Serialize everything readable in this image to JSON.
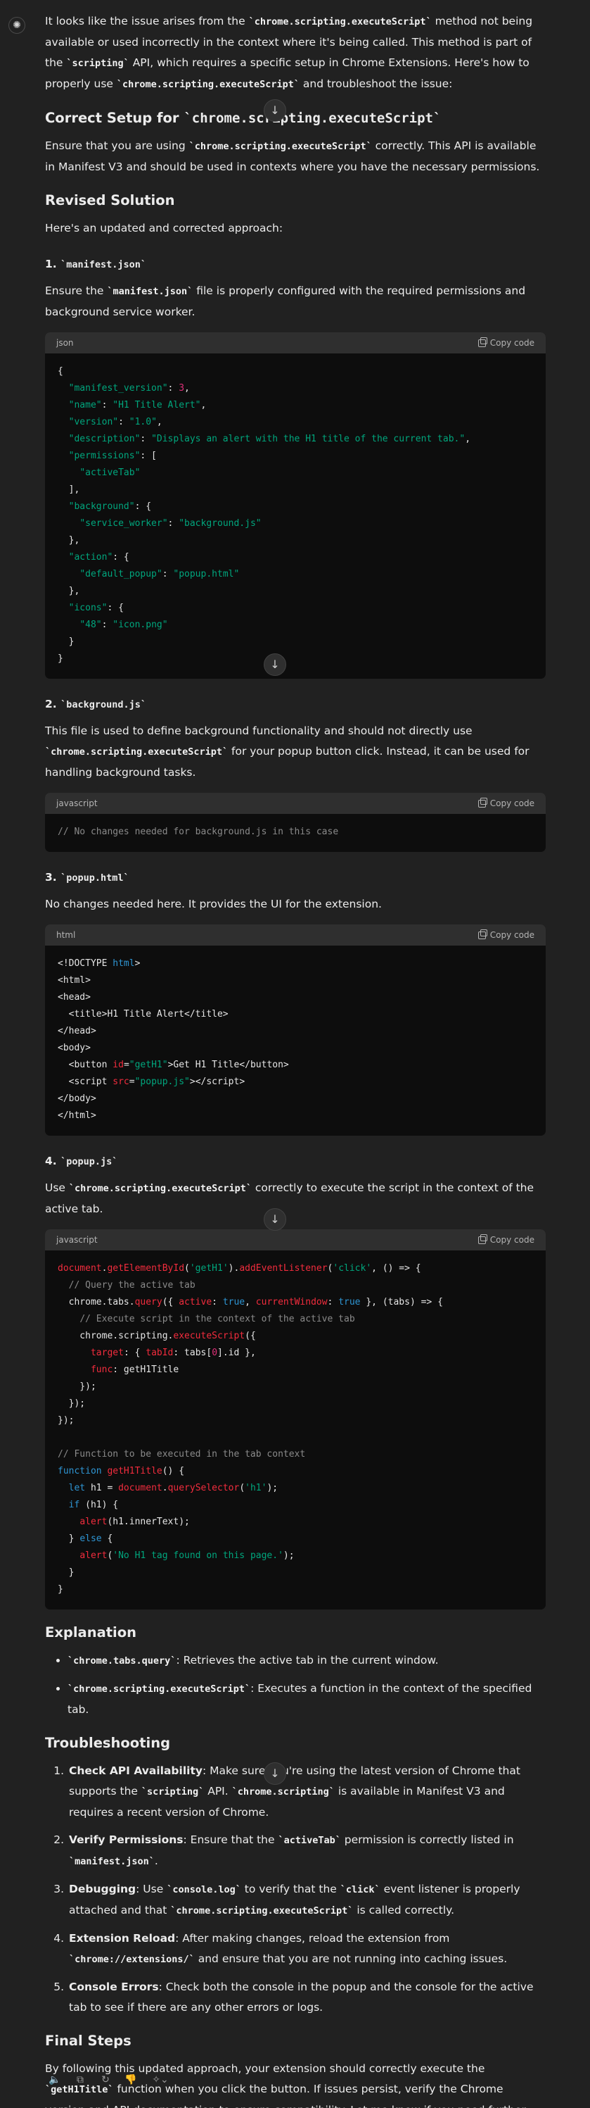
{
  "intro": {
    "p1_a": "It looks like the issue arises from the ",
    "p1_code1": "`chrome.scripting.executeScript`",
    "p1_b": " method not being available or used incorrectly in the context where it's being called. This method is part of the ",
    "p1_code2": "`scripting`",
    "p1_c": " API, which requires a specific setup in Chrome Extensions. Here's how to properly use ",
    "p1_code3": "`chrome.scripting.executeScript`",
    "p1_d": " and troubleshoot the issue:"
  },
  "correct_setup": {
    "heading_a": "Correct Setup for ",
    "heading_code": "`chrome.scripting.executeScript`",
    "p_a": "Ensure that you are using ",
    "p_code": "`chrome.scripting.executeScript`",
    "p_b": " correctly. This API is available in Manifest V3 and should be used in contexts where you have the necessary permissions."
  },
  "revised": {
    "heading": "Revised Solution",
    "intro": "Here's an updated and corrected approach:"
  },
  "step1": {
    "num": "1.",
    "file": "`manifest.json`",
    "p_a": "Ensure the ",
    "p_code": "`manifest.json`",
    "p_b": " file is properly configured with the required permissions and background service worker.",
    "lang": "json",
    "copy": "Copy code"
  },
  "step2": {
    "num": "2.",
    "file": "`background.js`",
    "p_a": "This file is used to define background functionality and should not directly use ",
    "p_code": "`chrome.scripting.executeScript`",
    "p_b": " for your popup button click. Instead, it can be used for handling background tasks.",
    "lang": "javascript",
    "copy": "Copy code",
    "code": "// No changes needed for background.js in this case"
  },
  "step3": {
    "num": "3.",
    "file": "`popup.html`",
    "p": "No changes needed here. It provides the UI for the extension.",
    "lang": "html",
    "copy": "Copy code"
  },
  "step4": {
    "num": "4.",
    "file": "`popup.js`",
    "p_a": "Use ",
    "p_code": "`chrome.scripting.executeScript`",
    "p_b": " correctly to execute the script in the context of the active tab.",
    "lang": "javascript",
    "copy": "Copy code"
  },
  "explanation": {
    "heading": "Explanation",
    "items": [
      {
        "code": "`chrome.tabs.query`",
        "text": ": Retrieves the active tab in the current window."
      },
      {
        "code": "`chrome.scripting.executeScript`",
        "text": ": Executes a function in the context of the specified tab."
      }
    ]
  },
  "troubleshooting": {
    "heading": "Troubleshooting",
    "i1_b": "Check API Availability",
    "i1_a": ": Make sure you're using the latest version of Chrome that supports the ",
    "i1_c1": "`scripting`",
    "i1_m": " API. ",
    "i1_c2": "`chrome.scripting`",
    "i1_e": " is available in Manifest V3 and requires a recent version of Chrome.",
    "i2_b": "Verify Permissions",
    "i2_a": ": Ensure that the ",
    "i2_c1": "`activeTab`",
    "i2_m": " permission is correctly listed in ",
    "i2_c2": "`manifest.json`",
    "i2_e": ".",
    "i3_b": "Debugging",
    "i3_a": ": Use ",
    "i3_c1": "`console.log`",
    "i3_m": " to verify that the ",
    "i3_c2": "`click`",
    "i3_n": " event listener is properly attached and that ",
    "i3_c3": "`chrome.scripting.executeScript`",
    "i3_e": " is called correctly.",
    "i4_b": "Extension Reload",
    "i4_a": ": After making changes, reload the extension from ",
    "i4_c1": "`chrome://extensions/`",
    "i4_e": " and ensure that you are not running into caching issues.",
    "i5_b": "Console Errors",
    "i5_a": ": Check both the console in the popup and the console for the active tab to see if there are any other errors or logs."
  },
  "final": {
    "heading": "Final Steps",
    "p_a": "By following this updated approach, your extension should correctly execute the ",
    "p_code": "`getH1Title`",
    "p_b": " function when you click the button. If issues persist, verify the Chrome version and API documentation to ensure compatibility. Let me know if you need further assistance or run into specific errors!"
  },
  "icons": {
    "avatar": "chatgpt-logo-icon",
    "scroll": "arrow-down-icon",
    "actions": [
      "speaker-icon",
      "copy-icon",
      "regenerate-icon",
      "thumbs-down-icon",
      "model-switch-icon"
    ]
  },
  "glyphs": {
    "avatar": "✺",
    "arrow": "↓",
    "speaker": "🔈",
    "copy": "⧉",
    "regen": "↻",
    "thumb": "👎",
    "spark": "✧⌄"
  }
}
